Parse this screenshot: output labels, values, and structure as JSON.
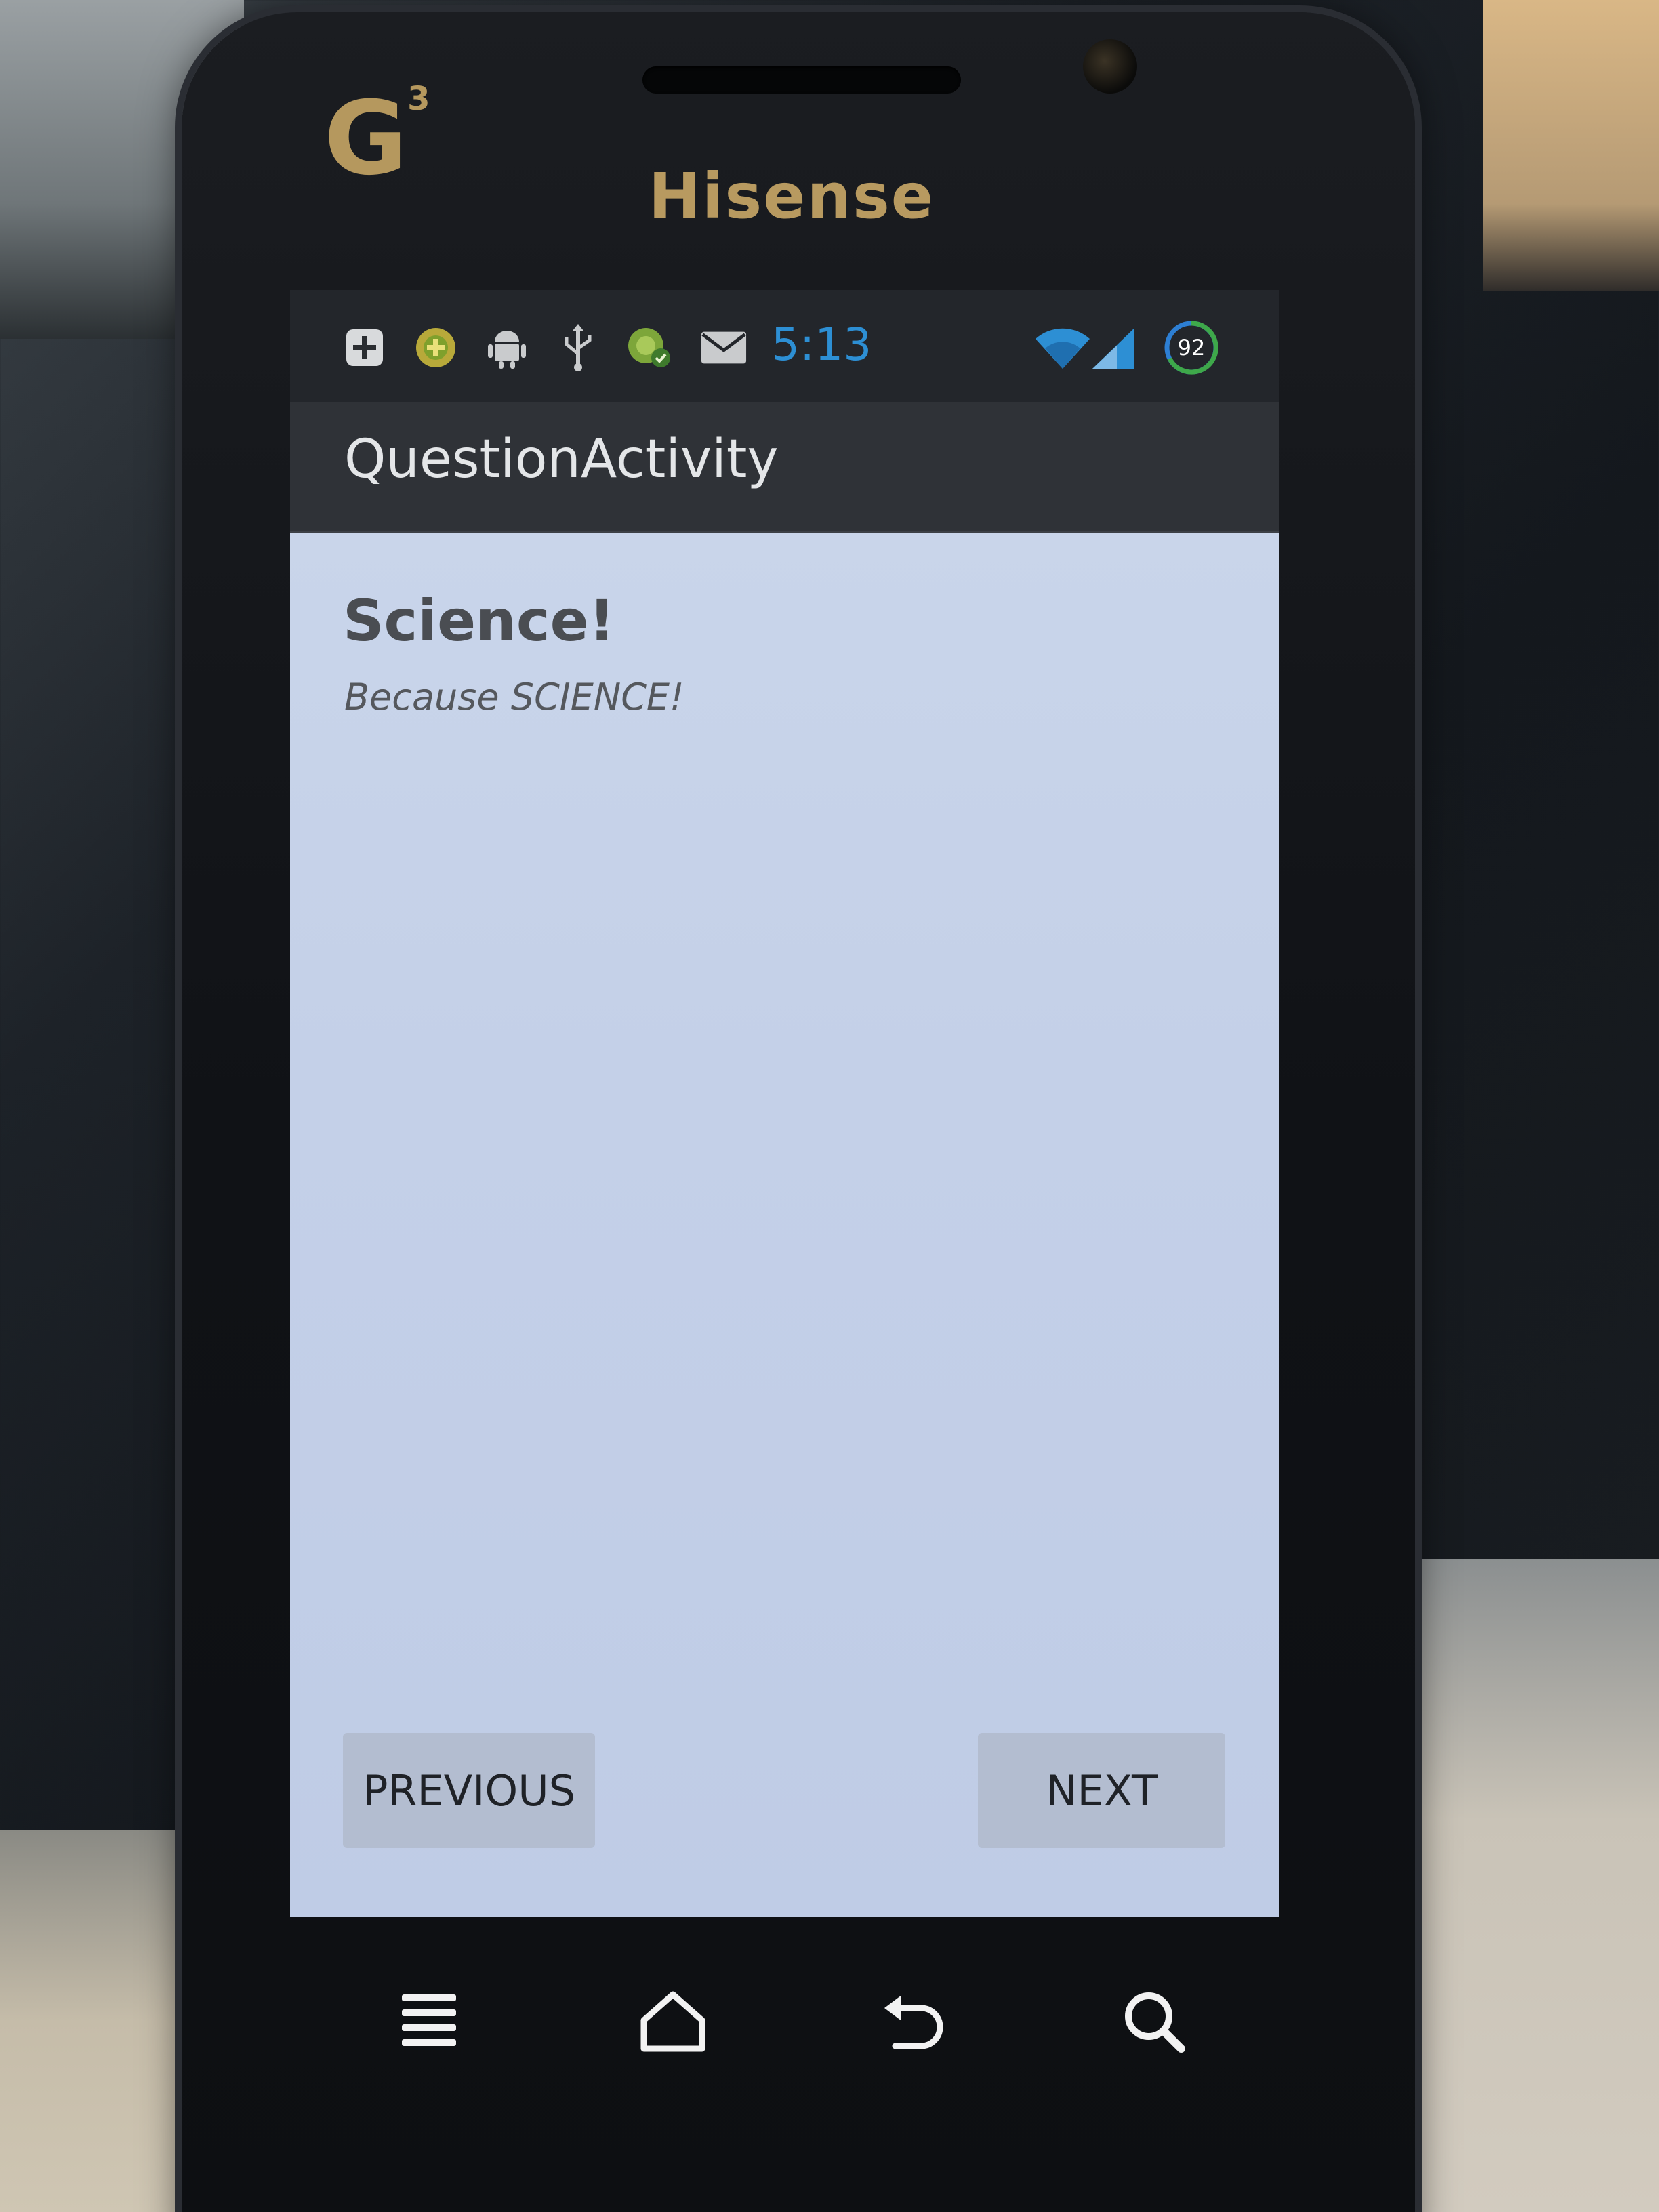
{
  "device": {
    "carrier_logo": "G",
    "carrier_sup": "3",
    "brand": "Hisense"
  },
  "status_bar": {
    "time": "5:13",
    "battery": "92",
    "icons": [
      "plus-notification-icon",
      "game-icon",
      "android-debug-icon",
      "usb-icon",
      "sync-icon",
      "email-icon",
      "wifi-icon",
      "signal-icon",
      "battery-icon"
    ]
  },
  "action_bar": {
    "title": "QuestionActivity"
  },
  "question": {
    "title": "Science!",
    "subtitle": "Because SCIENCE!"
  },
  "buttons": {
    "previous": "PREVIOUS",
    "next": "NEXT"
  },
  "hardware_keys": [
    "menu-icon",
    "home-icon",
    "back-icon",
    "search-icon"
  ],
  "colors": {
    "content_bg": "#c6d2e9",
    "action_bar": "#2f3237",
    "status_time": "#2d8fd4",
    "brand_gold": "#b89a60"
  }
}
